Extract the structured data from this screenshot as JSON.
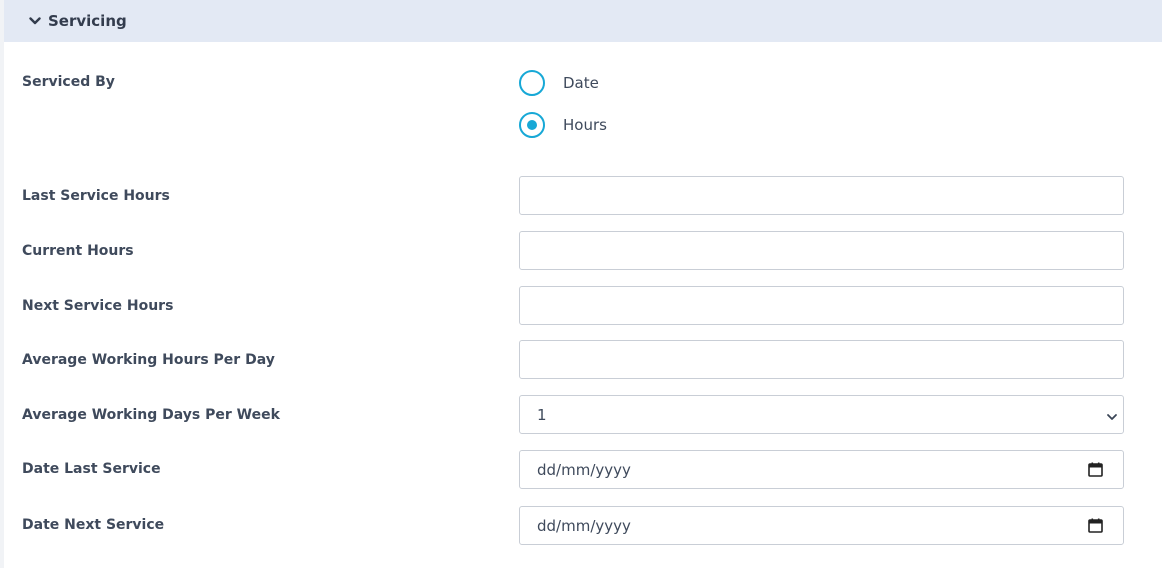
{
  "section": {
    "title": "Servicing",
    "collapse_icon": "chevron-down-icon"
  },
  "serviced_by": {
    "label": "Serviced By",
    "options": [
      {
        "label": "Date",
        "checked": false
      },
      {
        "label": "Hours",
        "checked": true
      }
    ]
  },
  "fields": {
    "last_service_hours": {
      "label": "Last Service Hours",
      "value": ""
    },
    "current_hours": {
      "label": "Current Hours",
      "value": ""
    },
    "next_service_hours": {
      "label": "Next Service Hours",
      "value": ""
    },
    "avg_hours_per_day": {
      "label": "Average Working Hours Per Day",
      "value": ""
    },
    "avg_days_per_week": {
      "label": "Average Working Days Per Week",
      "selected": "1",
      "icon": "chevron-down-icon"
    },
    "date_last_service": {
      "label": "Date Last Service",
      "placeholder": "dd/mm/yyyy",
      "icon": "calendar-icon"
    },
    "date_next_service": {
      "label": "Date Next Service",
      "placeholder": "dd/mm/yyyy",
      "icon": "calendar-icon"
    }
  },
  "colors": {
    "header_bg": "#e3e9f4",
    "accent": "#17a8d6",
    "border": "#c9ced6",
    "text": "#3f4a5c"
  }
}
